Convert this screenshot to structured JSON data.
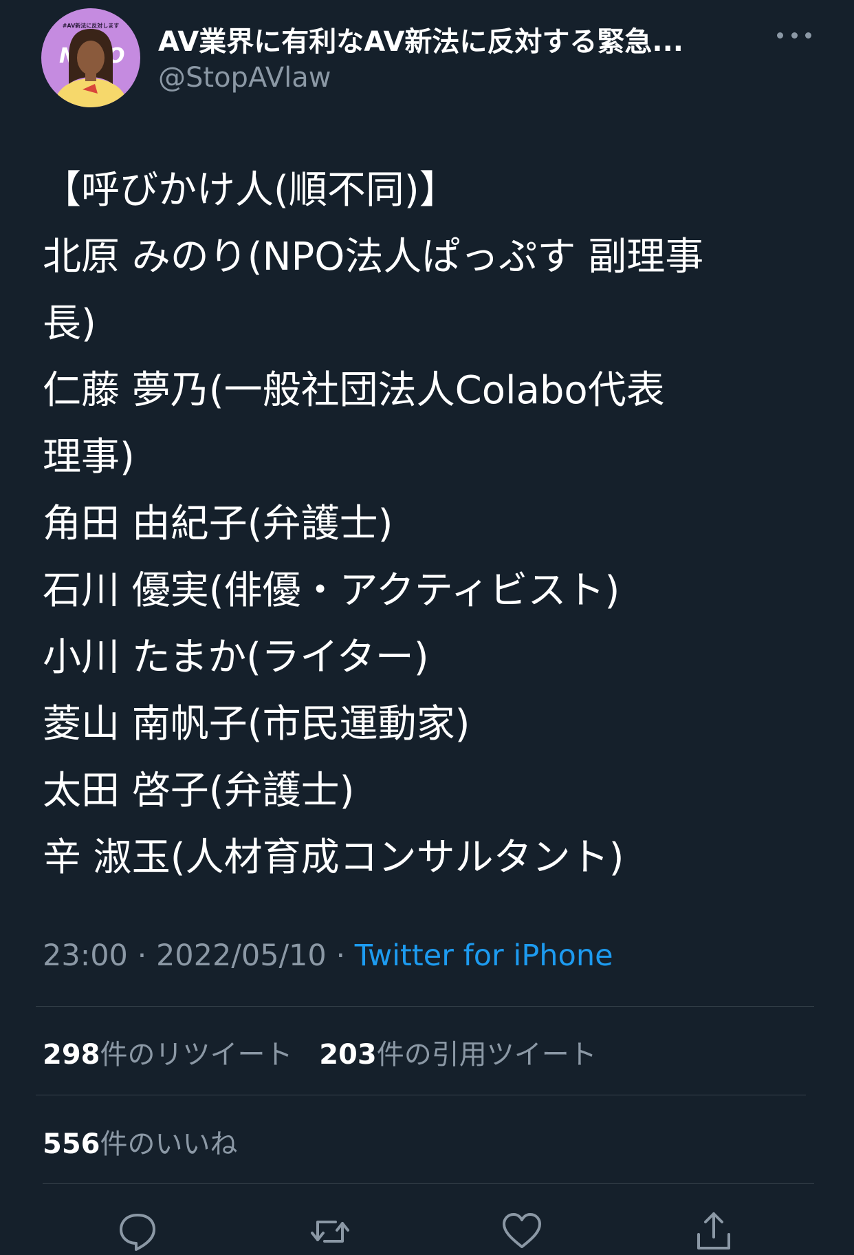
{
  "header": {
    "display_name": "AV業界に有利なAV新法に反対する緊急...",
    "handle": "@StopAVlaw",
    "avatar": {
      "caption": "#AV新法に反対します",
      "letters": [
        "N",
        "O"
      ],
      "icon": "avatar-illustration"
    },
    "more_icon": "more-dots-icon"
  },
  "tweet": {
    "lines": [
      "【呼びかけ人(順不同)】",
      "北原 みのり(NPO法人ぱっぷす 副理事",
      "長)",
      "仁藤 夢乃(一般社団法人Colabo代表",
      "理事)",
      "角田 由紀子(弁護士)",
      "石川 優実(俳優・アクティビスト)",
      "小川 たまか(ライター)",
      "菱山 南帆子(市民運動家)",
      "太田 啓子(弁護士)",
      "辛 淑玉(人材育成コンサルタント)"
    ]
  },
  "meta": {
    "time": "23:00",
    "separator": " · ",
    "date": "2022/05/10",
    "source": "Twitter for iPhone"
  },
  "stats": {
    "retweets_count": "298",
    "retweets_label": "件のリツイート",
    "quotes_count": "203",
    "quotes_label": "件の引用ツイート",
    "likes_count": "556",
    "likes_label": "件のいいね"
  },
  "actions": {
    "reply_icon": "reply-icon",
    "retweet_icon": "retweet-icon",
    "like_icon": "heart-icon",
    "share_icon": "share-icon"
  },
  "colors": {
    "background": "#15202b",
    "text_primary": "#ffffff",
    "text_secondary": "#8b98a5",
    "link": "#1d9bf0",
    "divider": "#38444d",
    "avatar_bg": "#c58be0"
  }
}
